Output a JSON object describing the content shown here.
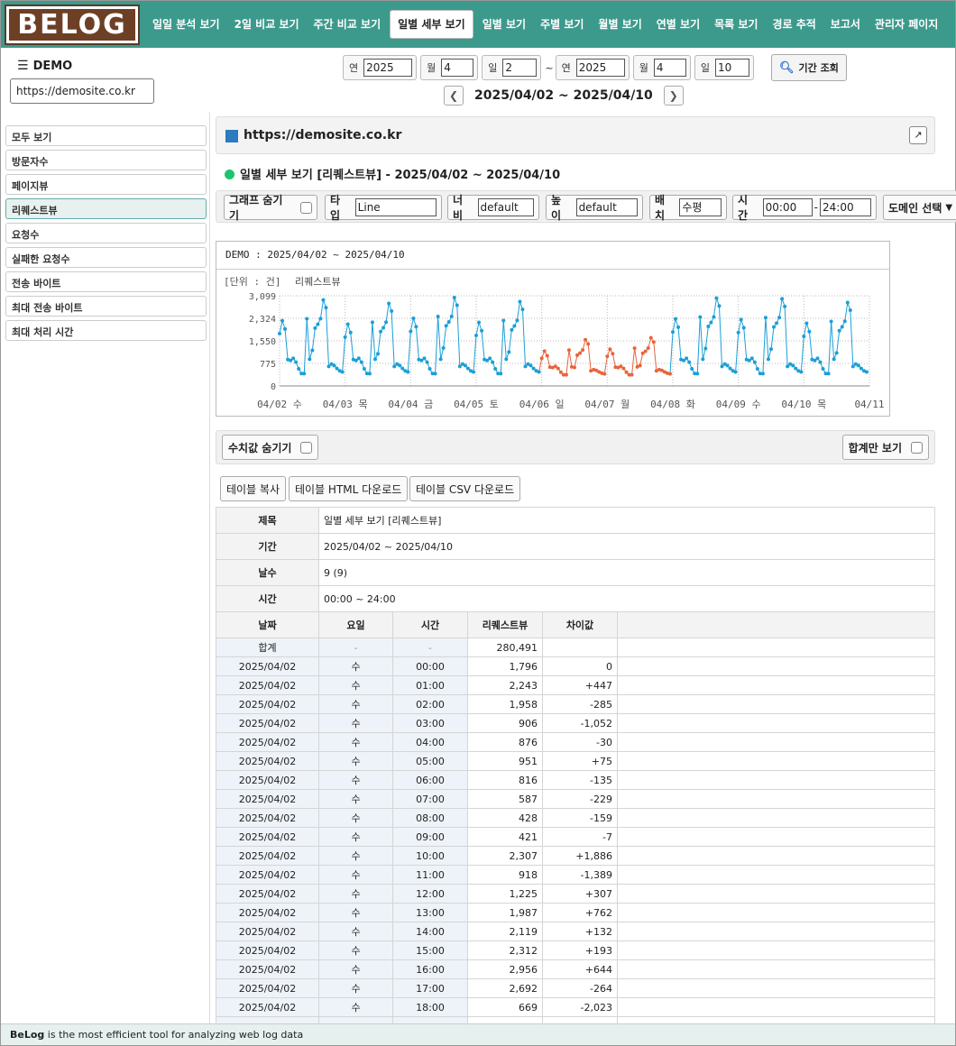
{
  "brand": {
    "logo": "BELOG"
  },
  "nav": [
    "일일 분석 보기",
    "2일 비교 보기",
    "주간 비교 보기",
    "일별 세부 보기",
    "일별 보기",
    "주별 보기",
    "월별 보기",
    "연별 보기",
    "목록 보기",
    "경로 추적",
    "보고서",
    "관리자 페이지"
  ],
  "nav_active": 3,
  "site": {
    "name": "DEMO",
    "url": "https://demosite.co.kr"
  },
  "date": {
    "labels": {
      "year": "연",
      "month": "월",
      "day": "일",
      "tilde": "~"
    },
    "from": {
      "year": "2025",
      "month": "4",
      "day": "2"
    },
    "to": {
      "year": "2025",
      "month": "4",
      "day": "10"
    },
    "search_label": "기간 조회",
    "range": "2025/04/02 ~ 2025/04/10"
  },
  "sidebar": [
    "모두 보기",
    "방문자수",
    "페이지뷰",
    "리퀘스트뷰",
    "요청수",
    "실패한 요청수",
    "전송 바이트",
    "최대 전송 바이트",
    "최대 처리 시간"
  ],
  "sidebar_active": 3,
  "panel": {
    "url": "https://demosite.co.kr",
    "subtitle": "일별 세부 보기 [리퀘스트뷰] - 2025/04/02 ~ 2025/04/10"
  },
  "options": {
    "hide_graph": "그래프 숨기기",
    "type_label": "타입",
    "type_value": "Line",
    "width_label": "너비",
    "width_value": "default",
    "height_label": "높이",
    "height_value": "default",
    "layout_label": "배치",
    "layout_value": "수평",
    "time_label": "시간",
    "time_from": "00:00",
    "time_sep": "-",
    "time_to": "24:00",
    "domain_select": "도메인 선택"
  },
  "chart_data": {
    "type": "line",
    "title": "DEMO : 2025/04/02 ~ 2025/04/10",
    "unit_label": "[단위 : 건]",
    "legend": "리퀘스트뷰",
    "ylim": [
      0,
      3099
    ],
    "yticks": [
      0,
      775,
      1550,
      2324,
      3099
    ],
    "xticks": [
      "04/02 수",
      "04/03 목",
      "04/04 금",
      "04/05 토",
      "04/06 일",
      "04/07 월",
      "04/08 화",
      "04/09 수",
      "04/10 목",
      "04/11"
    ],
    "colors": {
      "weekday": "#1a9fd8",
      "weekend": "#e8643a"
    },
    "weekend_days": [
      4,
      5
    ],
    "daily_pattern": [
      1796,
      2243,
      1958,
      906,
      876,
      951,
      816,
      587,
      428,
      421,
      2307,
      918,
      1225,
      1987,
      2119,
      2312,
      2956,
      2692,
      669,
      750,
      700,
      600,
      520,
      480
    ],
    "day_offsets": [
      0,
      -120,
      80,
      -60,
      -340,
      -220,
      60,
      40,
      -90
    ]
  },
  "table_opts": {
    "hide_values": "수치값 숨기기",
    "total_only": "합계만 보기"
  },
  "table_buttons": [
    "테이블 복사",
    "테이블 HTML 다운로드",
    "테이블 CSV 다운로드"
  ],
  "table": {
    "meta": [
      {
        "k": "제목",
        "v": "일별 세부 보기 [리퀘스트뷰]"
      },
      {
        "k": "기간",
        "v": "2025/04/02 ~ 2025/04/10"
      },
      {
        "k": "날수",
        "v": "9 (9)"
      },
      {
        "k": "시간",
        "v": "00:00 ~ 24:00"
      }
    ],
    "headers": [
      "날짜",
      "요일",
      "시간",
      "리퀘스트뷰",
      "차이값"
    ],
    "total": {
      "label": "합계",
      "dow": "-",
      "time": "-",
      "value": "280,491"
    },
    "rows": [
      [
        "2025/04/02",
        "수",
        "00:00",
        "1,796",
        "0"
      ],
      [
        "2025/04/02",
        "수",
        "01:00",
        "2,243",
        "+447"
      ],
      [
        "2025/04/02",
        "수",
        "02:00",
        "1,958",
        "-285"
      ],
      [
        "2025/04/02",
        "수",
        "03:00",
        "906",
        "-1,052"
      ],
      [
        "2025/04/02",
        "수",
        "04:00",
        "876",
        "-30"
      ],
      [
        "2025/04/02",
        "수",
        "05:00",
        "951",
        "+75"
      ],
      [
        "2025/04/02",
        "수",
        "06:00",
        "816",
        "-135"
      ],
      [
        "2025/04/02",
        "수",
        "07:00",
        "587",
        "-229"
      ],
      [
        "2025/04/02",
        "수",
        "08:00",
        "428",
        "-159"
      ],
      [
        "2025/04/02",
        "수",
        "09:00",
        "421",
        "-7"
      ],
      [
        "2025/04/02",
        "수",
        "10:00",
        "2,307",
        "+1,886"
      ],
      [
        "2025/04/02",
        "수",
        "11:00",
        "918",
        "-1,389"
      ],
      [
        "2025/04/02",
        "수",
        "12:00",
        "1,225",
        "+307"
      ],
      [
        "2025/04/02",
        "수",
        "13:00",
        "1,987",
        "+762"
      ],
      [
        "2025/04/02",
        "수",
        "14:00",
        "2,119",
        "+132"
      ],
      [
        "2025/04/02",
        "수",
        "15:00",
        "2,312",
        "+193"
      ],
      [
        "2025/04/02",
        "수",
        "16:00",
        "2,956",
        "+644"
      ],
      [
        "2025/04/02",
        "수",
        "17:00",
        "2,692",
        "-264"
      ],
      [
        "2025/04/02",
        "수",
        "18:00",
        "669",
        "-2,023"
      ]
    ]
  },
  "footer": {
    "brand": "BeLog",
    "text": " is the most efficient tool for analyzing web log data"
  }
}
